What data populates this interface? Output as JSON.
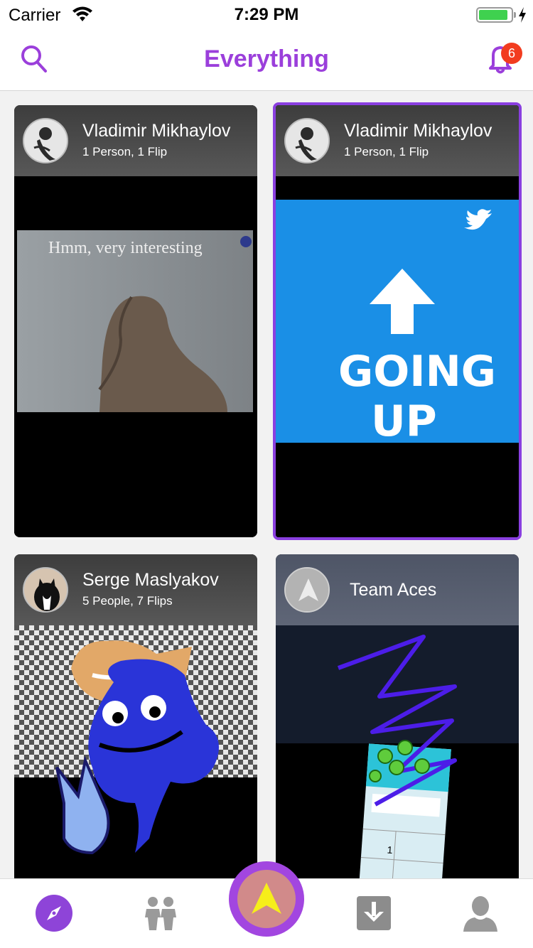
{
  "status_bar": {
    "carrier": "Carrier",
    "time": "7:29 PM"
  },
  "nav": {
    "title": "Everything",
    "notification_count": "6",
    "icons": [
      "search-icon",
      "bell-icon"
    ]
  },
  "feed": {
    "cards": [
      {
        "name": "Vladimir Mikhaylov",
        "subtitle": "1 Person, 1 Flip",
        "media_caption": "Hmm, very interesting",
        "selected": false
      },
      {
        "name": "Vladimir Mikhaylov",
        "subtitle": "1 Person, 1 Flip",
        "media_caption": "GOING UP",
        "selected": true
      },
      {
        "name": "Serge Maslyakov",
        "subtitle": "5 People, 7 Flips",
        "selected": false
      },
      {
        "name": "Team Aces",
        "subtitle": "",
        "selected": false
      }
    ]
  },
  "tab_bar": {
    "tabs": [
      "compass-icon",
      "people-icon",
      "record-icon",
      "download-icon",
      "profile-icon"
    ],
    "active": "compass-icon"
  },
  "colors": {
    "accent": "#9b3fdb",
    "badge": "#f23c1f",
    "battery": "#3fd14f",
    "center_button": "#a246e0"
  }
}
